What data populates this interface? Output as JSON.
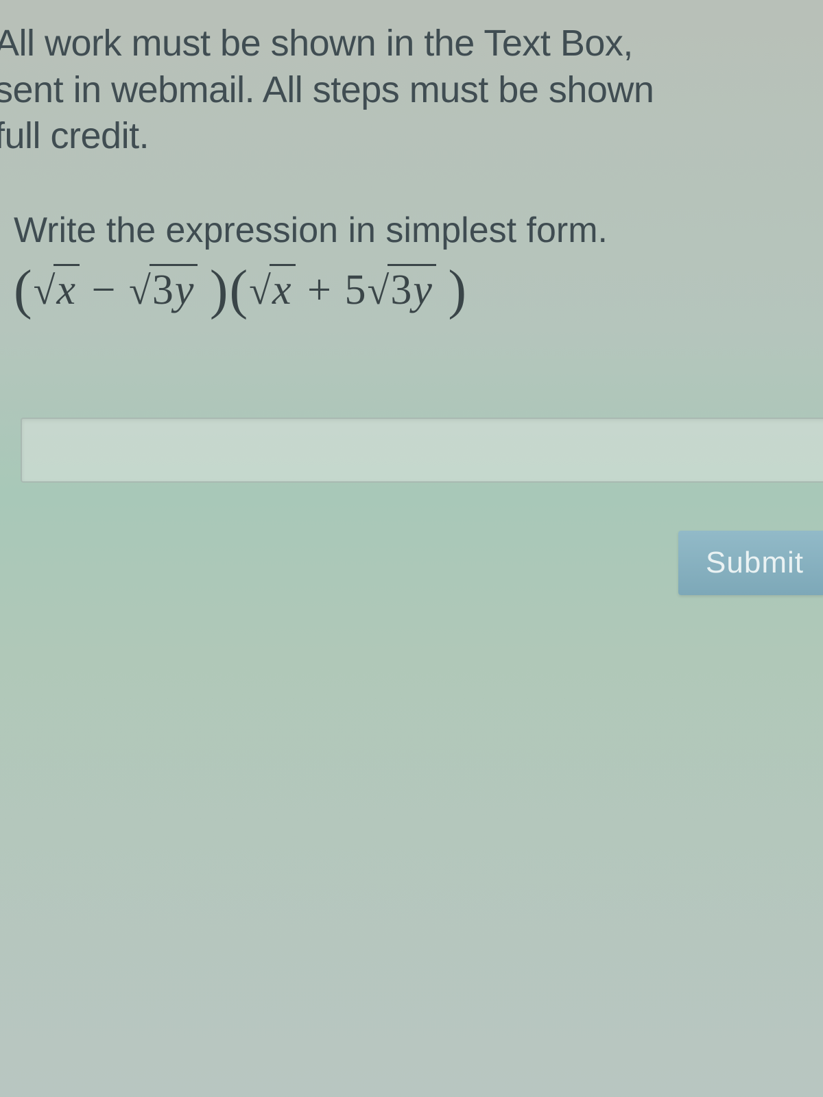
{
  "instructions": {
    "line1": "All work must be shown in the Text Box,",
    "line2": "sent in webmail. All steps must be shown",
    "line3": "full credit."
  },
  "question": {
    "prompt": "Write the expression in simplest form.",
    "expression_text": "(√x − √(3y))(√x + 5√(3y))",
    "expression_latex": "(\\sqrt{x} - \\sqrt{3y})(\\sqrt{x} + 5\\sqrt{3y})"
  },
  "answer": {
    "value": "",
    "placeholder": ""
  },
  "actions": {
    "submit_label": "Submit"
  }
}
